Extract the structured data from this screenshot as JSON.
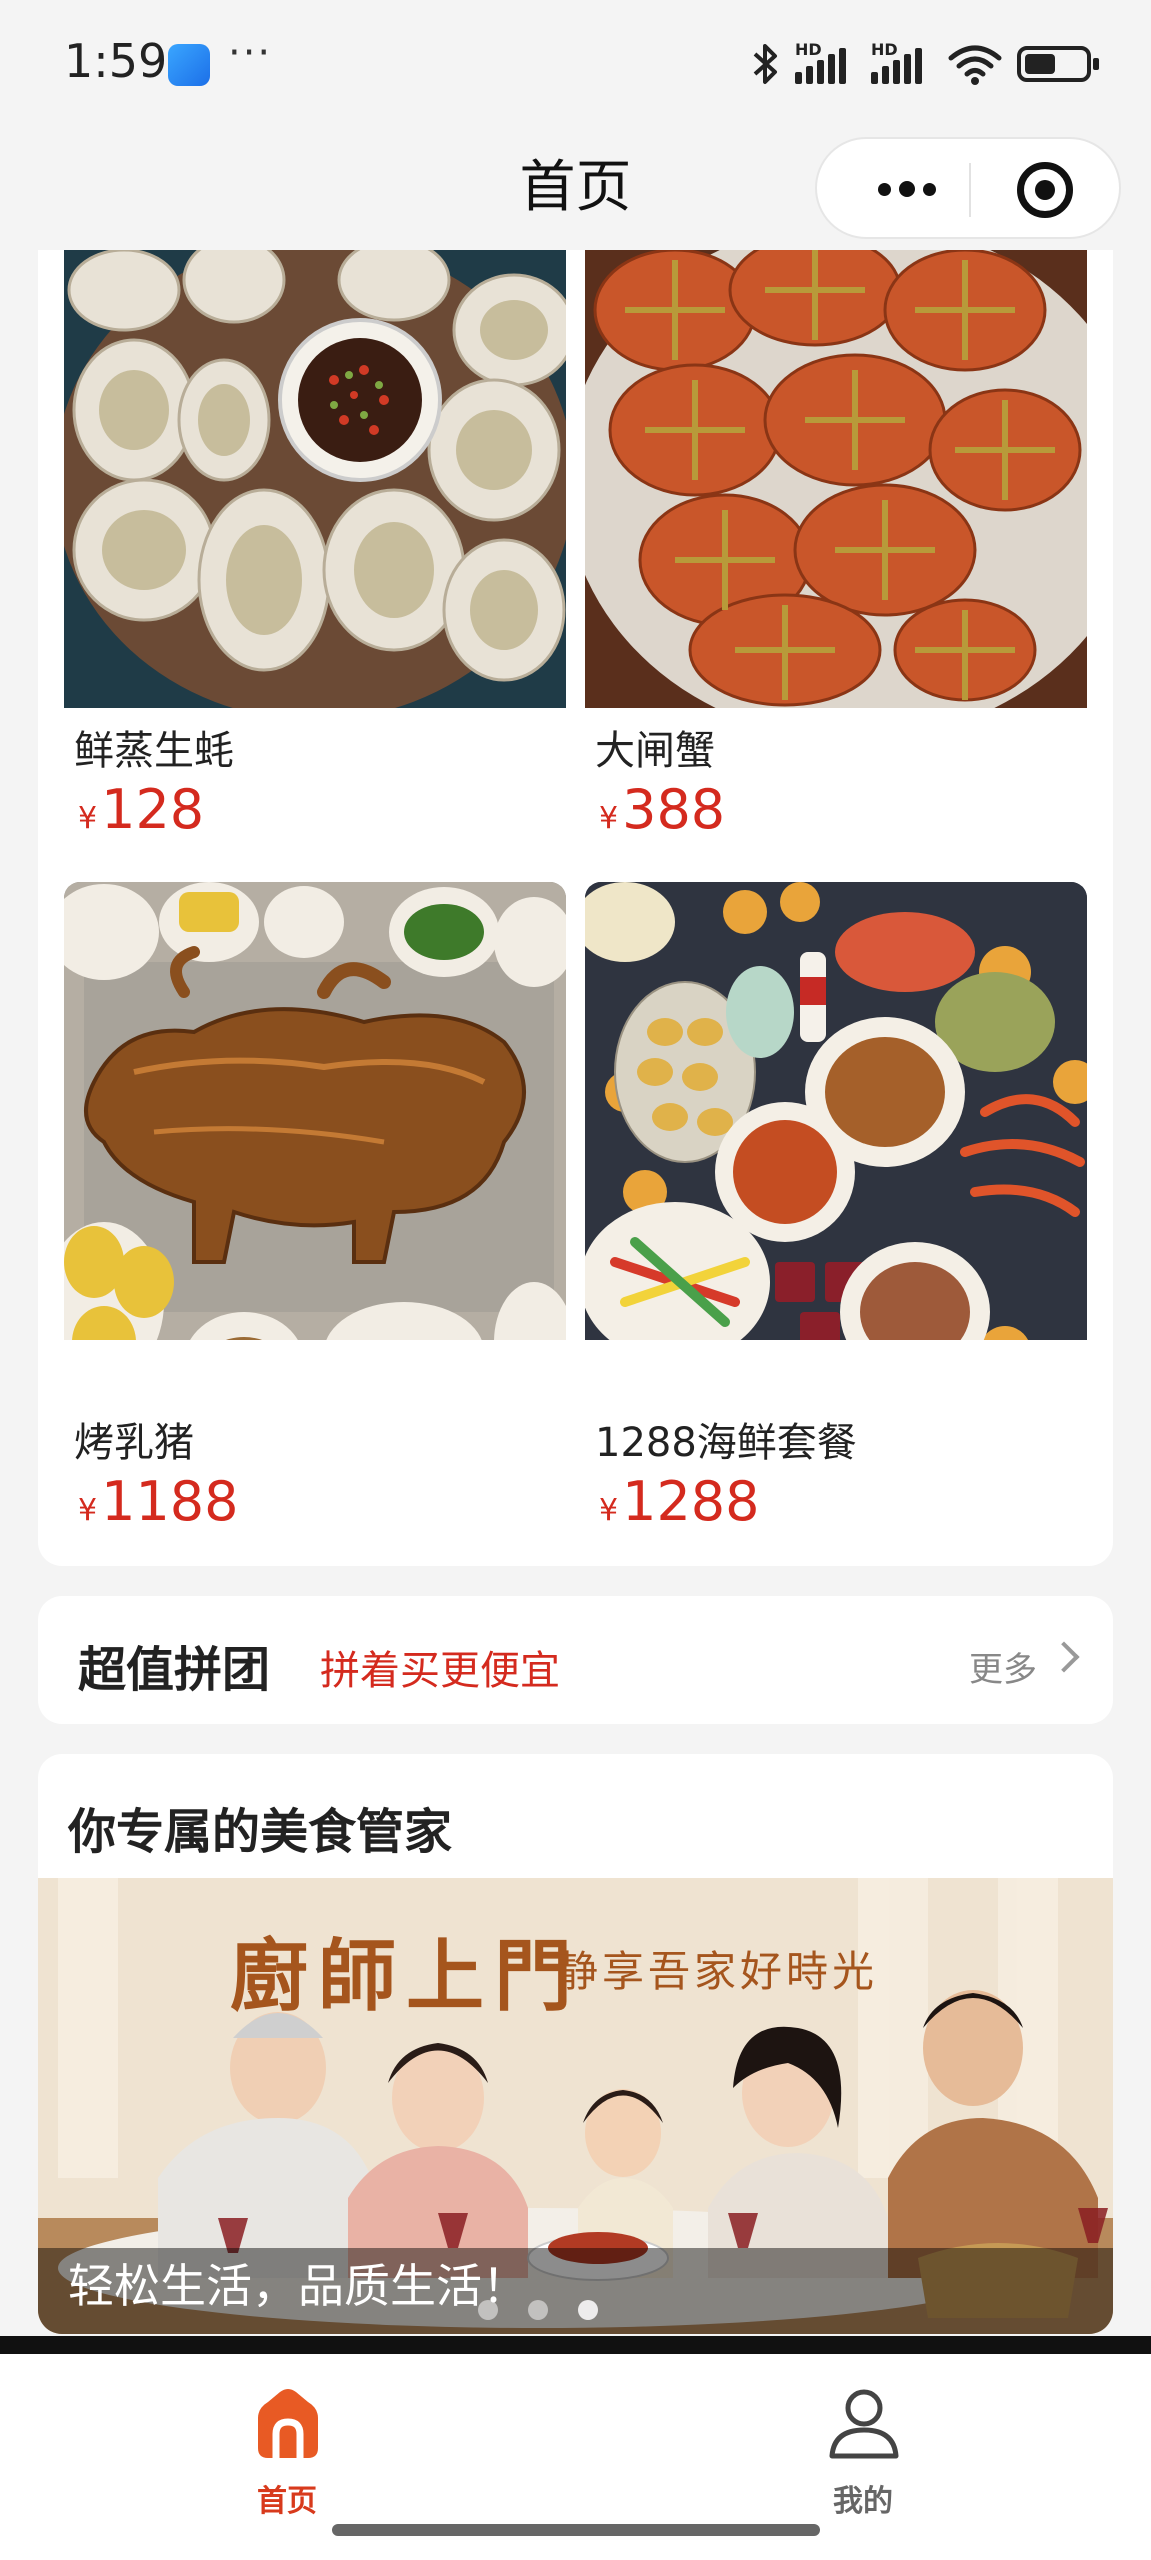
{
  "status_bar": {
    "time": "1:59",
    "app_icon": "blue-app-icon",
    "more": "···",
    "hd1": "HD",
    "hd2": "HD",
    "icons": [
      "bluetooth-icon",
      "signal-icon",
      "signal-icon",
      "wifi-icon",
      "battery-icon"
    ]
  },
  "nav": {
    "title": "首页",
    "capsule_more_icon": "more-dots-icon",
    "capsule_close_icon": "target-icon"
  },
  "products": [
    {
      "name": "鲜蒸生蚝",
      "currency": "¥",
      "price": "128",
      "image": "oysters-photo"
    },
    {
      "name": "大闸蟹",
      "currency": "¥",
      "price": "388",
      "image": "hairy-crabs-photo"
    },
    {
      "name": "烤乳猪",
      "currency": "¥",
      "price": "1188",
      "image": "roast-suckling-pig-photo"
    },
    {
      "name": "1288海鲜套餐",
      "currency": "¥",
      "price": "1288",
      "image": "seafood-set-photo"
    }
  ],
  "group_buy": {
    "title": "超值拼团",
    "subtitle": "拼着买更便宜",
    "more": "更多"
  },
  "butler": {
    "title": "你专属的美食管家",
    "banner_heading": "廚師上門",
    "banner_subheading": "静享吾家好時光",
    "banner_caption": "轻松生活，品质生活！",
    "banner_image": "family-dinner-photo"
  },
  "tabbar": {
    "items": [
      {
        "label": "首页",
        "icon": "home-icon",
        "active": true
      },
      {
        "label": "我的",
        "icon": "user-icon",
        "active": false
      }
    ]
  },
  "colors": {
    "accent": "#d42a1e",
    "tab_active": "#d83a1c",
    "banner_text": "#a5551d"
  }
}
